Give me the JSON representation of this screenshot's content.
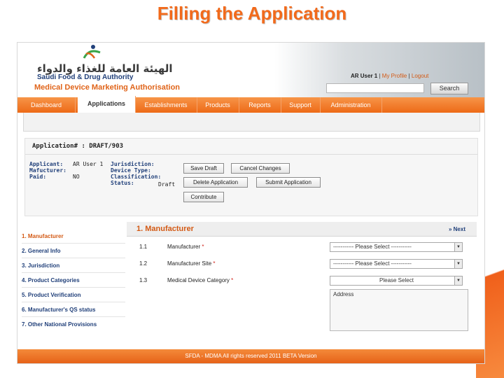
{
  "slide": {
    "title": "Filling the Application"
  },
  "brand": {
    "arabic_name": "الهيئة العامة للغذاء والدواء",
    "english_name": "Saudi Food & Drug Authority",
    "system_name": "Medical Device Marketing Authorisation"
  },
  "user_bar": {
    "user": "AR User 1",
    "sep1": "|",
    "profile": "My Profile",
    "sep2": "|",
    "logout": "Logout"
  },
  "search": {
    "value": "",
    "button": "Search"
  },
  "nav": {
    "tabs": [
      "Dashboard",
      "Applications",
      "Establishments",
      "Products",
      "Reports",
      "Support",
      "Administration"
    ],
    "active_index": 1
  },
  "application": {
    "id_label": "Application# : DRAFT/903",
    "fields": {
      "applicant_label": "Applicant:",
      "applicant_value": "AR User 1",
      "manufacturer_label": "Mafucturer:",
      "paid_label": "Paid:",
      "paid_value": "NO",
      "jurisdiction_label": "Jurisdiction:",
      "device_type_label": "Device Type:",
      "classification_label": "Classification:",
      "status_label": "Status:",
      "status_value": "Draft"
    },
    "buttons": {
      "save_draft": "Save Draft",
      "cancel_changes": "Cancel Changes",
      "delete_application": "Delete Application",
      "submit_application": "Submit Application",
      "contribute": "Contribute"
    }
  },
  "sidebar": {
    "items": [
      "1. Manufacturer",
      "2. General Info",
      "3. Jurisdiction",
      "4. Product Categories",
      "5. Product Verification",
      "6. Manufacturer's QS status",
      "7. Other National Provisions"
    ],
    "active_index": 0
  },
  "section": {
    "title": "1. Manufacturer",
    "next": "Next",
    "rows": [
      {
        "num": "1.1",
        "label": "Manufacturer",
        "select": "----------- Please Select -----------"
      },
      {
        "num": "1.2",
        "label": "Manufacturer Site",
        "select": "----------- Please Select -----------"
      },
      {
        "num": "1.3",
        "label": "Medical Device Category",
        "select": "Please Select"
      }
    ],
    "required_mark": "*",
    "address_label": "Address"
  },
  "footer": {
    "text": "SFDA - MDMA All rights reserved 2011 BETA Version"
  },
  "colors": {
    "accent": "#ed6a17",
    "title": "#f26a1b",
    "link": "#21407a",
    "required": "#d0231a"
  }
}
